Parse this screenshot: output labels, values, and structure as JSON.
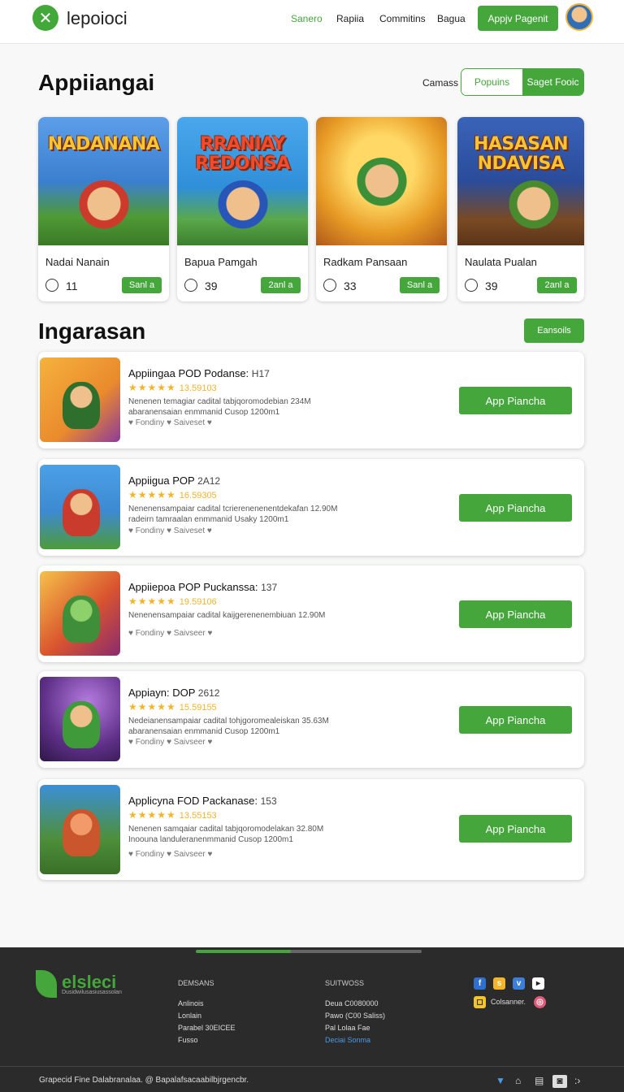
{
  "header": {
    "logo_text": "lepoioci",
    "nav": [
      "Sanero",
      "Rapiia",
      "Commitins",
      "Bagua"
    ],
    "cta": "Appjv Pagenit"
  },
  "featured": {
    "title": "Appiiangai",
    "sort_label": "Camass",
    "segments": [
      "Popuins",
      "Saget Fooic"
    ],
    "cards": [
      {
        "art_title": "NADANANA",
        "name": "Nadai Nanain",
        "count": "11",
        "button": "Sanl a",
        "bg": "#3b7fd0"
      },
      {
        "art_title": "RRANIAY REDONSA",
        "name": "Bapua Pamgah",
        "count": "39",
        "button": "2anl a",
        "bg": "#2f8fd8"
      },
      {
        "art_title": "",
        "name": "Radkam Pansaan",
        "count": "33",
        "button": "Sanl a",
        "bg": "#e79a24"
      },
      {
        "art_title": "HASASAN NDAVISA",
        "name": "Naulata Pualan",
        "count": "39",
        "button": "2anl a",
        "bg": "#2a4c9a"
      }
    ]
  },
  "list": {
    "title": "Ingarasan",
    "more_button": "Eansoils",
    "items": [
      {
        "title": "Appiingaa POD Podanse:",
        "suffix": "H17",
        "stars": "★★★★★",
        "rating": "13.59103",
        "desc1": "Nenenen temagiar cadital tabjqoromodebian 234M",
        "desc2": "abaranensaian enmmanid Cusop 1200m1",
        "meta": "♥ Fondiny ♥  Saiveset ♥",
        "button": "App Piancha",
        "bg": "#e98a2d"
      },
      {
        "title": "Appiigua POP",
        "suffix": "2A12",
        "stars": "★★★★★",
        "rating": "16.59305",
        "desc1": "Nenenensampaiar cadital tcrierenenenentdekafan 12.90M",
        "desc2": "radeirn tamraalan enmmanid Usaky 1200m1",
        "meta": "♥ Fondiny ♥  Saiveset ♥",
        "button": "App Piancha",
        "bg": "#3d8ad2"
      },
      {
        "title": "Appiiepoa POP Puckanssa:",
        "suffix": "137",
        "stars": "★★★★★",
        "rating": "19.59106",
        "desc1": "Nenenensampaiar cadital kaijgerenenembiuan 12.90M",
        "desc2": "",
        "meta": "♥ Fondiny ♥  Saivseer ♥",
        "button": "App Piancha",
        "bg": "#d9542e"
      },
      {
        "title": "Appiayn: DOP",
        "suffix": "2612",
        "stars": "★★★★★",
        "rating": "15.59155",
        "desc1": "Nedeianensampaiar cadital tohjgoromealeiskan 35.63M",
        "desc2": "abaranensaian enmmanid Cusop 1200m1",
        "meta": "♥ Fondiny ♥  Saivseer ♥",
        "button": "App Piancha",
        "bg": "#5d2f86"
      },
      {
        "title": "Applicyna FOD Packanase:",
        "suffix": "153",
        "stars": "★★★★★",
        "rating": "13.55153",
        "desc1": "Nenenen samqaiar cadital tabjqoromodelakan 32.80M",
        "desc2": "Inoouna landuleranenmmanid Cusop 1200m1",
        "meta": "♥ Fondiny ♥  Saivseer ♥",
        "button": "App Piancha",
        "bg": "#4d8f3a"
      }
    ]
  },
  "footer": {
    "progress": 0.42,
    "brand": "elsleci",
    "tagline": "Dusidwilusasiusassolan",
    "col1_head": "DEMSANS",
    "col1": [
      "Anlinois",
      "Lonlain",
      "Parabel 30EICEE",
      "Fusso"
    ],
    "col2_head": "SUITWOSS",
    "col2": [
      "Deua C0080000",
      "Pawo (C00 Saliss)",
      "Pal Lolaa Fae"
    ],
    "col2_link": "Deciai Sonma",
    "social_label": "Colsanner.",
    "copyright": "Grapecid Fine Dalabranalaa. @ Bapalafsacaabilbjrgencbr.",
    "colors": {
      "accent": "#45a63b",
      "dark": "#2b2b2b"
    }
  }
}
